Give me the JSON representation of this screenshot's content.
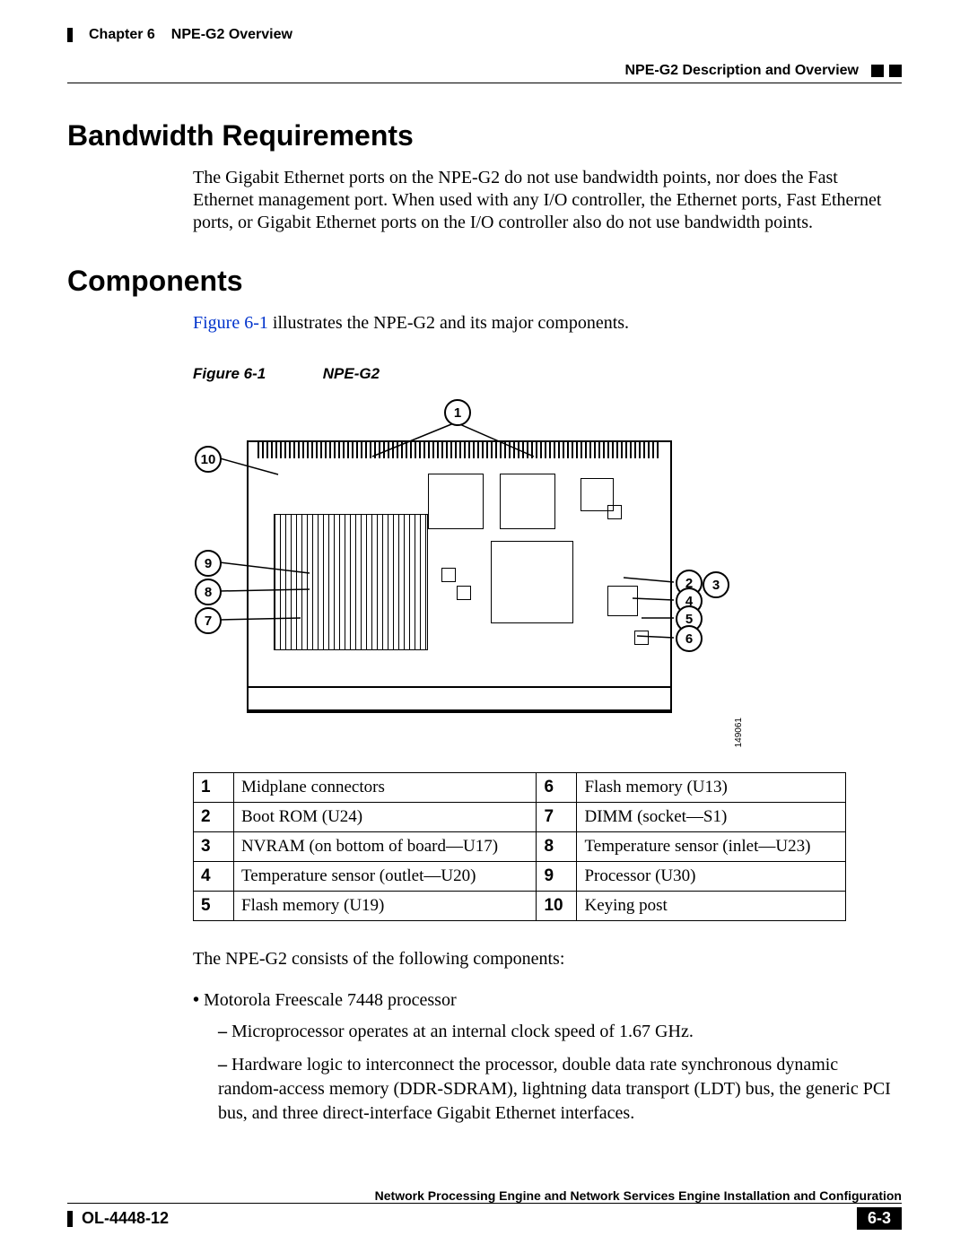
{
  "header": {
    "chapter": "Chapter 6",
    "title": "NPE-G2 Overview",
    "section": "NPE-G2 Description and Overview"
  },
  "h1_bw": "Bandwidth Requirements",
  "bw_text": "The Gigabit Ethernet ports on the NPE-G2 do not use bandwidth points, nor does the Fast Ethernet management port. When used with any I/O controller, the Ethernet ports, Fast Ethernet ports, or Gigabit Ethernet ports on the I/O controller also do not use bandwidth points.",
  "h1_comp": "Components",
  "comp_intro_link": "Figure 6-1",
  "comp_intro_rest": " illustrates the NPE-G2 and its major components.",
  "fig_caption_num": "Figure 6-1",
  "fig_caption_title": "NPE-G2",
  "fig_code": "149061",
  "callouts": {
    "1": "1",
    "2": "2",
    "3": "3",
    "4": "4",
    "5": "5",
    "6": "6",
    "7": "7",
    "8": "8",
    "9": "9",
    "10": "10"
  },
  "table": [
    {
      "n": "1",
      "d": "Midplane connectors",
      "n2": "6",
      "d2": "Flash memory (U13)"
    },
    {
      "n": "2",
      "d": "Boot ROM (U24)",
      "n2": "7",
      "d2": "DIMM (socket—S1)"
    },
    {
      "n": "3",
      "d": "NVRAM (on bottom of board—U17)",
      "n2": "8",
      "d2": "Temperature sensor (inlet—U23)"
    },
    {
      "n": "4",
      "d": "Temperature sensor (outlet—U20)",
      "n2": "9",
      "d2": "Processor (U30)"
    },
    {
      "n": "5",
      "d": "Flash memory (U19)",
      "n2": "10",
      "d2": "Keying post"
    }
  ],
  "post_table": "The NPE-G2 consists of the following components:",
  "bullet1": "Motorola Freescale 7448 processor",
  "sub1": "Microprocessor operates at an internal clock speed of 1.67 GHz.",
  "sub2": "Hardware logic to interconnect the processor, double data rate synchronous dynamic random-access memory (DDR-SDRAM), lightning data transport (LDT) bus, the generic PCI bus, and three direct-interface Gigabit Ethernet interfaces.",
  "footer": {
    "doc": "Network Processing Engine and Network Services Engine Installation and Configuration",
    "code": "OL-4448-12",
    "page": "6-3"
  }
}
